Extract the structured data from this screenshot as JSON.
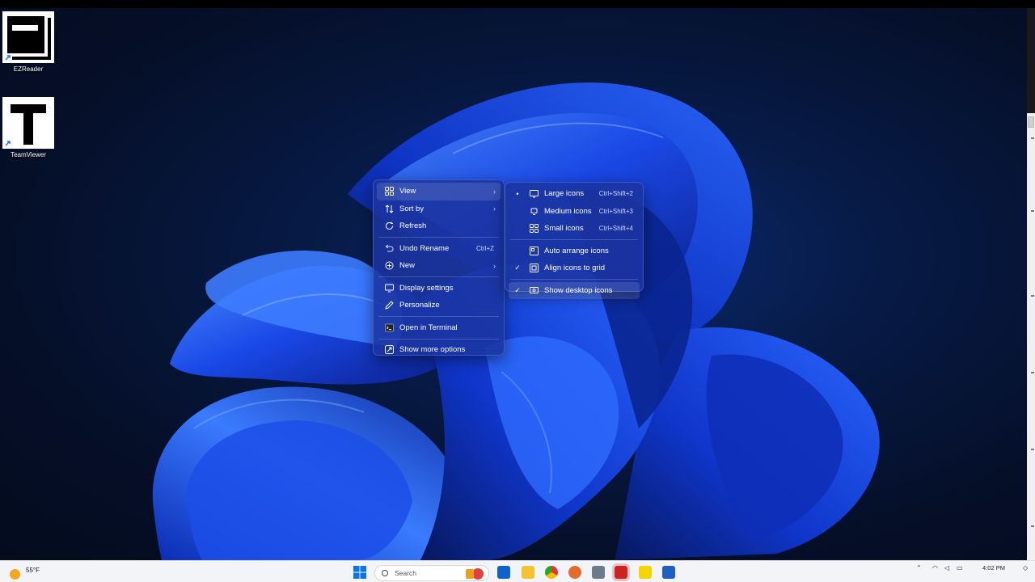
{
  "desktop": {
    "icons": [
      {
        "label": "EZReader"
      },
      {
        "label": "TeamViewer"
      }
    ]
  },
  "context_menu": {
    "items": [
      {
        "label": "View",
        "shortcut": "",
        "icon": "view-grid-icon",
        "has_submenu": true
      },
      {
        "label": "Sort by",
        "shortcut": "",
        "icon": "sort-icon",
        "has_submenu": true
      },
      {
        "label": "Refresh",
        "shortcut": "",
        "icon": "refresh-icon",
        "has_submenu": false
      },
      {
        "label": "Undo Rename",
        "shortcut": "Ctrl+Z",
        "icon": "undo-icon",
        "has_submenu": false
      },
      {
        "label": "New",
        "shortcut": "",
        "icon": "new-icon",
        "has_submenu": true
      },
      {
        "label": "Display settings",
        "shortcut": "",
        "icon": "display-icon",
        "has_submenu": false
      },
      {
        "label": "Personalize",
        "shortcut": "",
        "icon": "pen-icon",
        "has_submenu": false
      },
      {
        "label": "Open in Terminal",
        "shortcut": "",
        "icon": "terminal-icon",
        "has_submenu": false
      },
      {
        "label": "Show more options",
        "shortcut": "",
        "icon": "more-options-icon",
        "has_submenu": false
      }
    ]
  },
  "view_submenu": {
    "items": [
      {
        "label": "Large icons",
        "shortcut": "Ctrl+Shift+2",
        "mark": "•"
      },
      {
        "label": "Medium icons",
        "shortcut": "Ctrl+Shift+3",
        "mark": ""
      },
      {
        "label": "Small icons",
        "shortcut": "Ctrl+Shift+4",
        "mark": ""
      },
      {
        "label": "Auto arrange icons",
        "shortcut": "",
        "mark": ""
      },
      {
        "label": "Align icons to grid",
        "shortcut": "",
        "mark": "✓"
      },
      {
        "label": "Show desktop icons",
        "shortcut": "",
        "mark": "✓"
      }
    ]
  },
  "taskbar": {
    "weather_temp": "55°F",
    "search_placeholder": "Search",
    "clock_time": "4:02 PM"
  },
  "colors": {
    "menu_bg": "#1b34a0",
    "taskbar_bg": "#f3f4f7",
    "accent": "#0a5cff"
  }
}
